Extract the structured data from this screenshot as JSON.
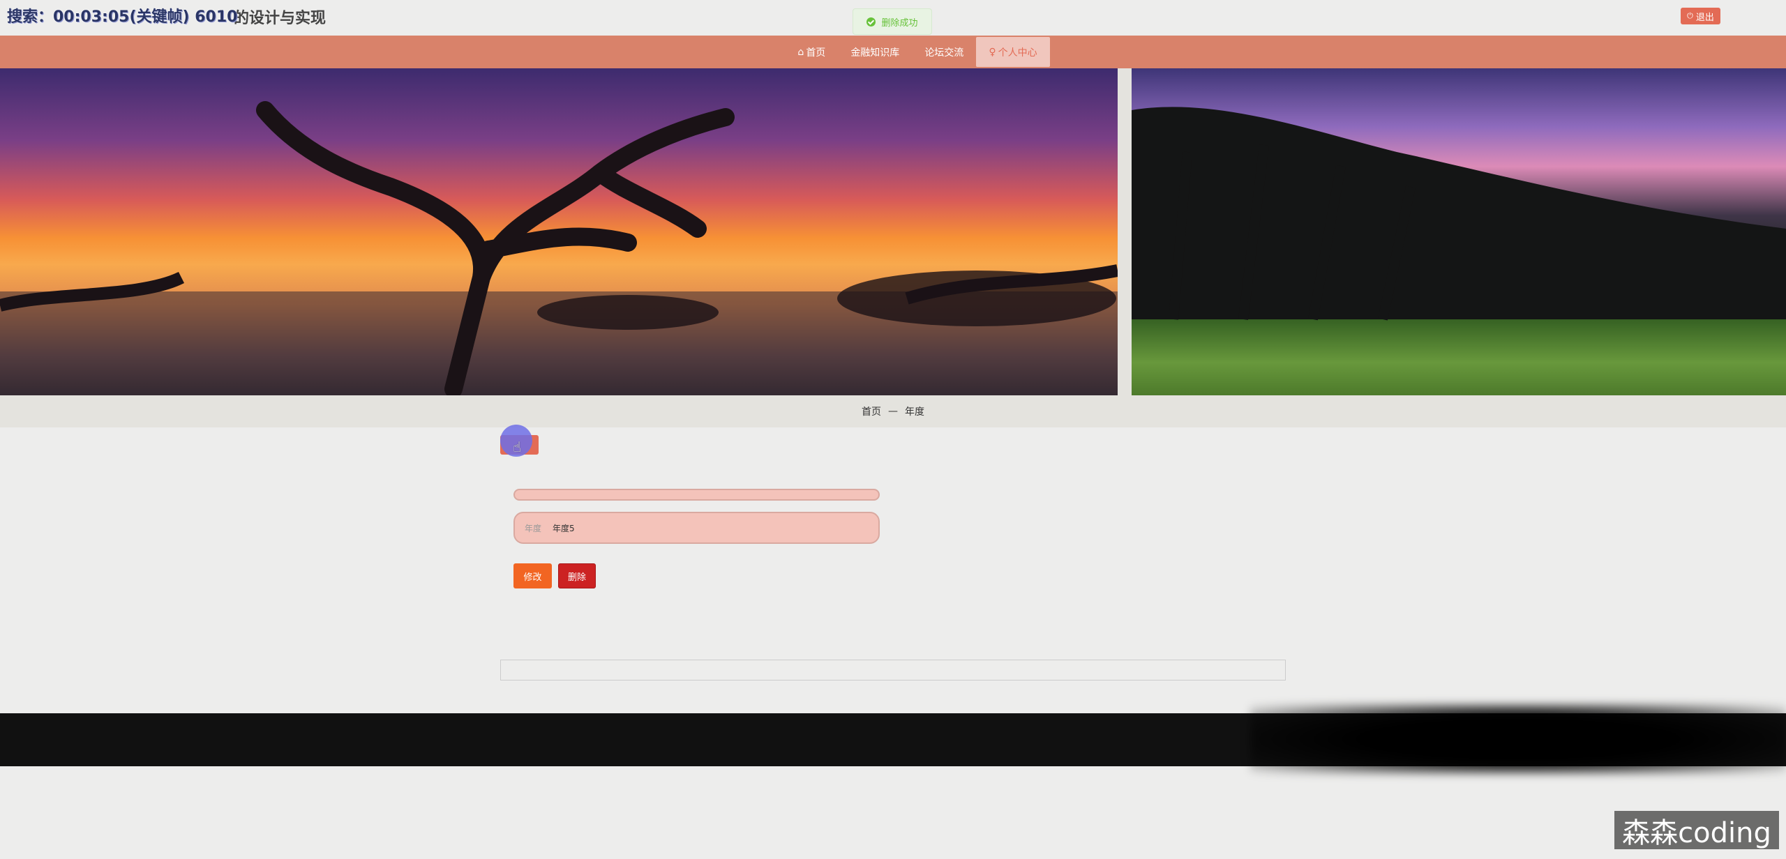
{
  "header": {
    "overlay_text": "搜索：00:03:05(关键帧) 6010",
    "site_title": "的设计与实现",
    "toast": "删除成功",
    "logout_label": "退出"
  },
  "nav": {
    "items": [
      {
        "icon": "⌂",
        "label": "首页"
      },
      {
        "icon": "",
        "label": "金融知识库"
      },
      {
        "icon": "",
        "label": "论坛交流"
      },
      {
        "icon": "♀",
        "label": "个人中心"
      }
    ]
  },
  "breadcrumb": {
    "home": "首页",
    "separator": "—",
    "current": "年度"
  },
  "form": {
    "year_label": "年度",
    "year_value": "年度5"
  },
  "actions": {
    "edit_label": "修改",
    "delete_label": "删除"
  },
  "watermark": "森森coding",
  "colors": {
    "accent": "#d9826a",
    "danger": "#cc2222",
    "warn": "#f26522",
    "success": "#67c23a"
  }
}
